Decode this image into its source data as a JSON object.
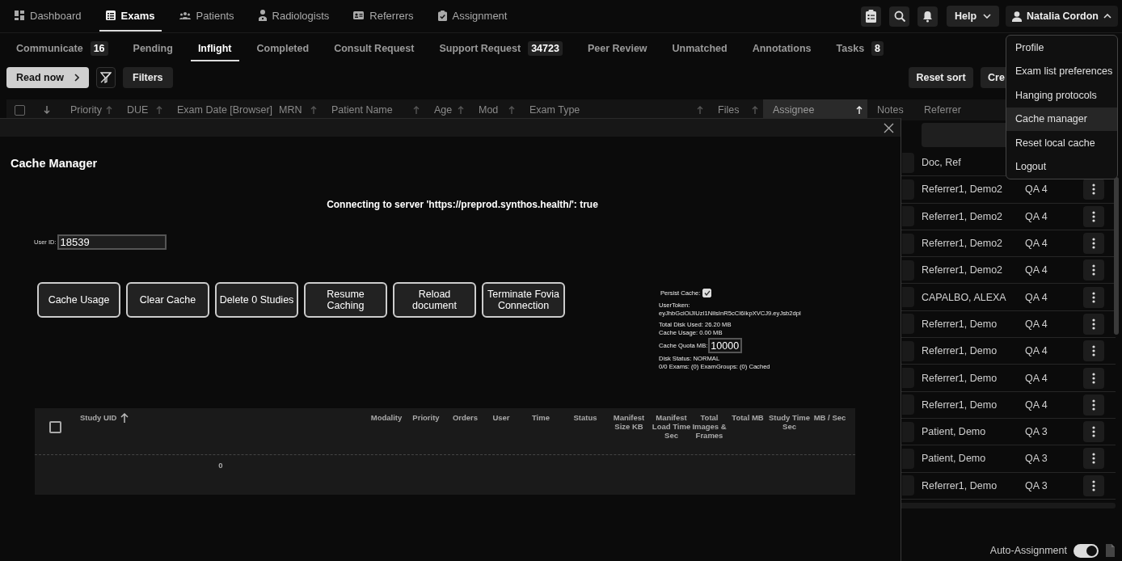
{
  "nav": {
    "items": [
      {
        "label": "Dashboard",
        "selected": false
      },
      {
        "label": "Exams",
        "selected": true
      },
      {
        "label": "Patients",
        "selected": false
      },
      {
        "label": "Radiologists",
        "selected": false
      },
      {
        "label": "Referrers",
        "selected": false
      },
      {
        "label": "Assignment",
        "selected": false
      }
    ],
    "help": "Help",
    "user": "Natalia Cordon"
  },
  "tabs": [
    {
      "label": "Communicate",
      "count": "16",
      "selected": false
    },
    {
      "label": "Pending",
      "selected": false
    },
    {
      "label": "Inflight",
      "selected": true
    },
    {
      "label": "Completed",
      "selected": false
    },
    {
      "label": "Consult Request",
      "selected": false
    },
    {
      "label": "Support Request",
      "count": "34723",
      "selected": false
    },
    {
      "label": "Peer Review",
      "selected": false
    },
    {
      "label": "Unmatched",
      "selected": false
    },
    {
      "label": "Annotations",
      "selected": false
    },
    {
      "label": "Tasks",
      "count": "8",
      "selected": false
    }
  ],
  "toolbar": {
    "read_now": "Read now",
    "filters": "Filters",
    "reset_sort": "Reset sort",
    "create": "Cre"
  },
  "worklist": {
    "select_all": false,
    "columns": [
      {
        "label": "Priority",
        "sortable": true,
        "sorted": false
      },
      {
        "label": "DUE",
        "sortable": true,
        "sorted": false
      },
      {
        "label": "Exam Date [Browser]",
        "sortable": false,
        "sorted": false
      },
      {
        "label": "MRN",
        "sortable": true,
        "sorted": false
      },
      {
        "label": "Patient Name",
        "sortable": true,
        "sorted": false
      },
      {
        "label": "Age",
        "sortable": true,
        "sorted": false
      },
      {
        "label": "Mod",
        "sortable": true,
        "sorted": false
      },
      {
        "label": "Exam Type",
        "sortable": true,
        "sorted": false
      },
      {
        "label": "Files",
        "sortable": true,
        "sorted": false
      },
      {
        "label": "Assignee",
        "sortable": true,
        "sorted": true
      },
      {
        "label": "Notes",
        "sortable": false,
        "sorted": false
      },
      {
        "label": "Referrer",
        "sortable": false,
        "sorted": false
      }
    ],
    "rows": [
      {
        "referrer": "Doc, Ref"
      },
      {
        "referrer": "Referrer1, Demo2",
        "assignee": "QA 4"
      },
      {
        "referrer": "Referrer1, Demo2",
        "assignee": "QA 4"
      },
      {
        "referrer": "Referrer1, Demo2",
        "assignee": "QA 4"
      },
      {
        "referrer": "Referrer1, Demo2",
        "assignee": "QA 4"
      },
      {
        "referrer": "CAPALBO, ALEXA",
        "assignee": "QA 4"
      },
      {
        "referrer": "Referrer1, Demo",
        "assignee": "QA 4"
      },
      {
        "referrer": "Referrer1, Demo",
        "assignee": "QA 4"
      },
      {
        "referrer": "Referrer1, Demo",
        "assignee": "QA 4"
      },
      {
        "referrer": "Referrer1, Demo",
        "assignee": "QA 4"
      },
      {
        "referrer": "Patient, Demo",
        "assignee": "QA 3"
      },
      {
        "referrer": "Patient, Demo",
        "assignee": "QA 3"
      },
      {
        "referrer": "Referrer1, Demo",
        "assignee": "QA 3"
      }
    ],
    "auto_assignment": {
      "label": "Auto-Assignment",
      "on": true
    }
  },
  "menu": {
    "items": [
      {
        "label": "Profile",
        "selected": false
      },
      {
        "label": "Exam list preferences",
        "selected": false
      },
      {
        "label": "Hanging protocols",
        "selected": false
      },
      {
        "label": "Cache manager",
        "selected": true
      },
      {
        "label": "Reset local cache",
        "selected": false
      },
      {
        "label": "Logout",
        "selected": false
      }
    ]
  },
  "modal": {
    "title": "Cache Manager",
    "status": "Connecting to server 'https://preprod.synthos.health/': true",
    "user_id_label": "User ID:",
    "user_id": "18539",
    "buttons": [
      "Cache Usage",
      "Clear Cache",
      "Delete 0 Studies",
      "Resume Caching",
      "Reload document",
      "Terminate Fovia Connection"
    ],
    "persist_label": "Persist Cache:",
    "persist": true,
    "token_label": "UserToken:",
    "token": "eyJhbGciOiJIUzI1NiIsInR5cCI6IkpXVCJ9.eyJsb2dpl",
    "disk_used": "Total Disk Used: 26.20 MB",
    "cache_usage": "Cache Usage: 0.00 MB",
    "quota_label": "Cache Quota MB:",
    "quota": "10000",
    "disk_status": "Disk Status: NORMAL",
    "cached": "0/0 Exams: (0) ExamGroups: (0) Cached",
    "table": {
      "select_all": false,
      "columns": [
        "Study UID",
        "Modality",
        "Priority",
        "Orders",
        "User",
        "Time",
        "Status",
        "Manifest Size KB",
        "Manifest Load Time Sec",
        "Total Images & Frames",
        "Total MB",
        "Study Time Sec",
        "MB / Sec"
      ],
      "rows": [
        {
          "study_uid": "0"
        }
      ]
    }
  }
}
